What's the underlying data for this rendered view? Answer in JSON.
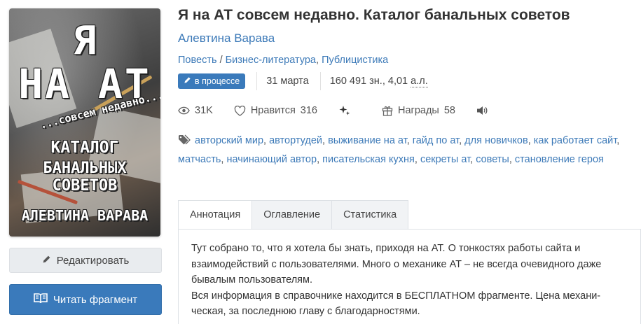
{
  "cover": {
    "line1": "Я",
    "line2": "НА АТ",
    "line3": "...совсем недавно...",
    "line4": "КАТАЛОГ",
    "line5": "БАНАЛЬНЫХ СОВЕТОВ",
    "line6": "АЛЕВТИНА ВАРАВА"
  },
  "buttons": {
    "edit_label": "Редактировать",
    "read_label": "Читать фрагмент"
  },
  "book": {
    "title": "Я на АТ совсем недавно. Каталог банальных советов",
    "author": "Алевтина Варава",
    "genre_1": "Повесть",
    "genre_sep": " / ",
    "genre_2": "Бизнес-литература",
    "genre_comma": ", ",
    "genre_3": "Публицистика"
  },
  "meta": {
    "status_badge": "в процессе",
    "date": "31 марта",
    "chars": "160 491 зн.,",
    "sheets_value": "4,01",
    "sheets_unit": "а.л."
  },
  "stats": {
    "views": "31K",
    "likes_label": "Нравится",
    "likes_count": "316",
    "awards_label": "Награды",
    "awards_count": "58"
  },
  "tags": [
    "авторский мир",
    "автортудей",
    "выживание на ат",
    "гайд по ат",
    "для новичков",
    "как работает сайт",
    "матчасть",
    "начинающий автор",
    "писательская кухня",
    "секреты ат",
    "советы",
    "становление героя"
  ],
  "tabs": [
    {
      "label": "Аннотация",
      "active": true
    },
    {
      "label": "Оглавление",
      "active": false
    },
    {
      "label": "Статистика",
      "active": false
    }
  ],
  "annotation": {
    "line1": "Тут собрано то, что я хотела бы знать, приходя на АТ. О тонкостях работы сайта и взаимодействий с пользователями. Много о механике АТ – не всегда очевидного даже бывалым пользователям.",
    "line2": "Вся информация в справочнике находится в БЕСПЛАТНОМ фрагменте. Цена механи-ческая, за последнюю главу с благодарностями."
  },
  "colors": {
    "accent": "#3a7abb",
    "link": "#3d7ab8",
    "edit_button_bg": "#e9ecef"
  },
  "icons": {
    "edit": "pencil-icon",
    "read": "open-book-icon",
    "status": "pencil-icon",
    "views": "eye-icon",
    "likes": "heart-icon",
    "sparkle": "sparkles-icon",
    "awards": "gift-icon",
    "audio": "speaker-icon",
    "tags": "tag-icon"
  }
}
